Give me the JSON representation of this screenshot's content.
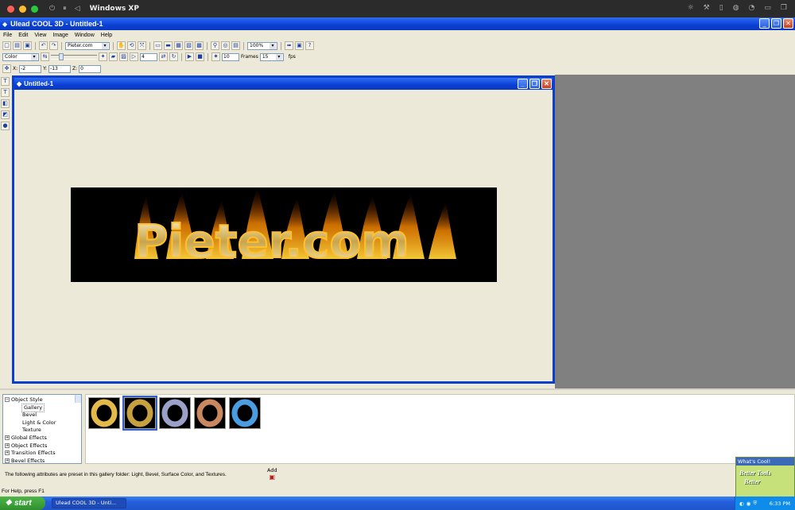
{
  "mac": {
    "title": "Windows XP"
  },
  "app": {
    "title": "Ulead COOL 3D - Untitled-1"
  },
  "menu": [
    "File",
    "Edit",
    "View",
    "Image",
    "Window",
    "Help"
  ],
  "toolbar1": {
    "text_combo": "Pieter.com",
    "zoom_combo": "100%"
  },
  "toolbar2": {
    "color_combo": "Color",
    "bevel_value": "4",
    "fps_input": "10",
    "frames_label": "Frames",
    "frames_value": "15",
    "fps_label": "fps"
  },
  "toolbar3": {
    "x_label": "X:",
    "x_value": "-2",
    "y_label": "Y:",
    "y_value": "-13",
    "z_label": "Z:",
    "z_value": "0"
  },
  "document": {
    "title": "Untitled-1",
    "canvas_text": "Pieter.com"
  },
  "panel": {
    "tree": [
      {
        "label": "Object Style",
        "level": 0,
        "expanded": true
      },
      {
        "label": "Gallery",
        "level": 1,
        "selected": true
      },
      {
        "label": "Bevel",
        "level": 1
      },
      {
        "label": "Light & Color",
        "level": 1
      },
      {
        "label": "Texture",
        "level": 1
      },
      {
        "label": "Global Effects",
        "level": 0
      },
      {
        "label": "Object Effects",
        "level": 0
      },
      {
        "label": "Transition Effects",
        "level": 0
      },
      {
        "label": "Bevel Effects",
        "level": 0
      }
    ],
    "description": "The following attributes are preset in this gallery folder: Light, Bevel, Surface Color, and Textures.",
    "add_label": "Add"
  },
  "whats_cool": {
    "header": "What's Cool!",
    "line1": "Better Tools",
    "line2": "Better"
  },
  "status": "For Help, press F1",
  "taskbar": {
    "start_label": "start",
    "task_item": "Ulead COOL 3D - Unti...",
    "clock": "6:33 PM"
  }
}
